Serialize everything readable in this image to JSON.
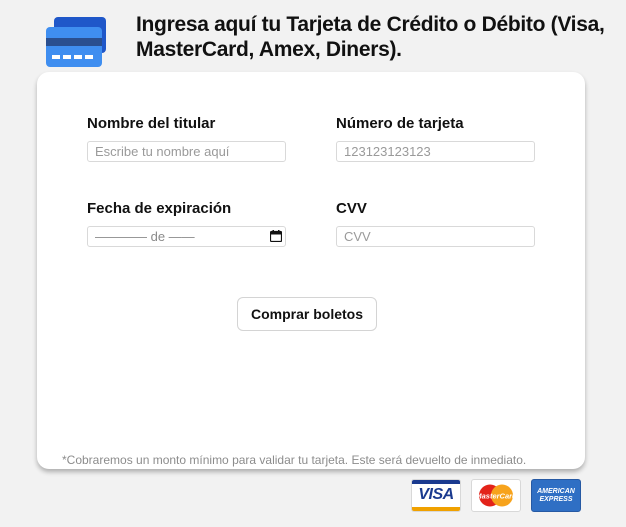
{
  "header": {
    "title": "Ingresa aquí tu Tarjeta de Crédito o Débito (Visa, MasterCard, Amex, Diners).",
    "icon": "credit-card-icon",
    "accent_color": "#2f7de1"
  },
  "form": {
    "holder_name": {
      "label": "Nombre del titular",
      "value": "",
      "placeholder": "Escribe tu nombre aquí"
    },
    "card_number": {
      "label": "Número de tarjeta",
      "value": "",
      "placeholder": "123123123123"
    },
    "expiration": {
      "label": "Fecha de expiración",
      "display": "———— de ——",
      "icon": "calendar-icon"
    },
    "cvv": {
      "label": "CVV",
      "value": "",
      "placeholder": "CVV"
    },
    "submit_label": "Comprar boletos"
  },
  "disclaimer": "*Cobraremos un monto mínimo para validar tu tarjeta. Este será devuelto de inmediato.",
  "card_logos": {
    "visa": "VISA",
    "mastercard": "MasterCard",
    "amex_line1": "AMERICAN",
    "amex_line2": "EXPRESS"
  }
}
